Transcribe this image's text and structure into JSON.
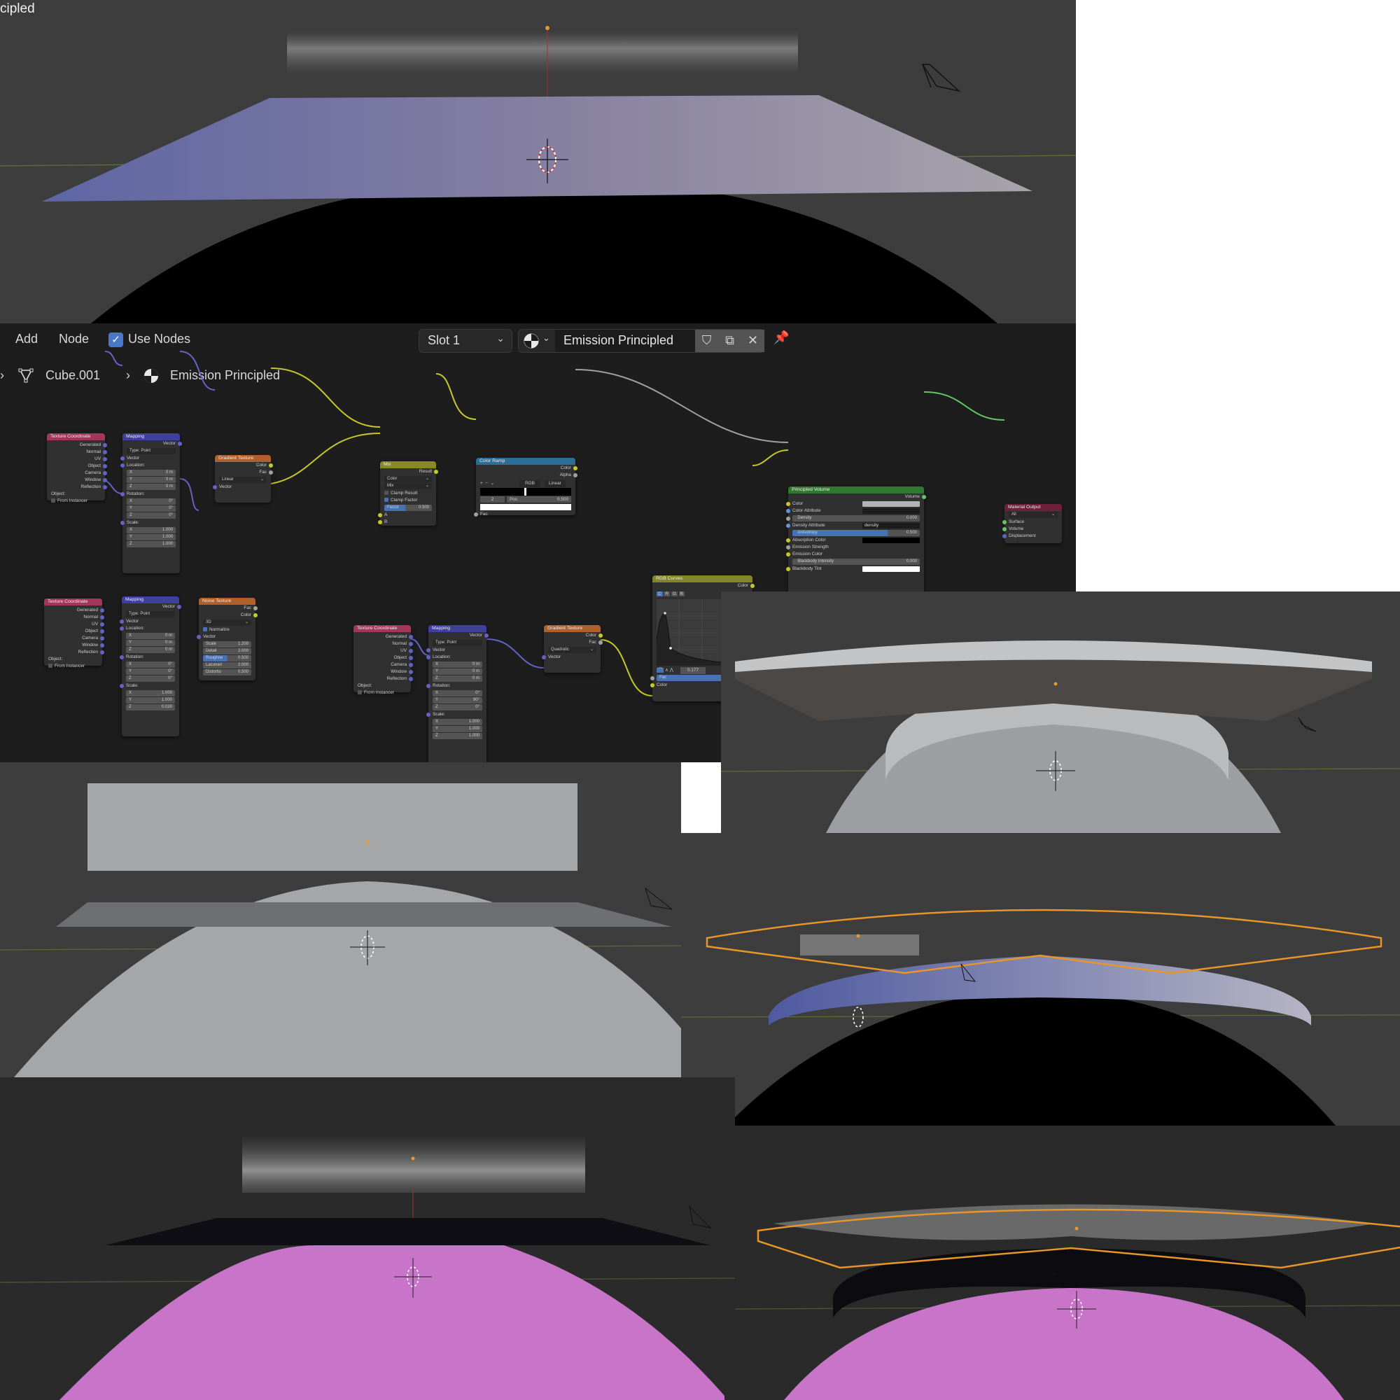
{
  "viewport_top": {
    "title_fragment": "cipled",
    "accent": "#e59a2e"
  },
  "node_editor": {
    "header": {
      "menu": [
        "Add",
        "Node"
      ],
      "use_nodes_label": "Use Nodes",
      "use_nodes_checked": true,
      "slot": "Slot 1",
      "material_name": "Emission Principled",
      "icons": [
        "material-sphere-icon",
        "fake-user-shield-icon",
        "duplicate-icon",
        "close-icon",
        "pin-icon"
      ]
    },
    "breadcrumb": {
      "object": "Cube.001",
      "material": "Emission Principled"
    },
    "nodes": {
      "texcoord1": {
        "title": "Texture Coordinate",
        "outputs": [
          "Generated",
          "Normal",
          "UV",
          "Object",
          "Camera",
          "Window",
          "Reflection"
        ],
        "object_label": "Object:",
        "from_instancer": "From Instancer"
      },
      "mapping1": {
        "title": "Mapping",
        "output": "Vector",
        "type_label": "Type:",
        "type_value": "Point",
        "vector_label": "Vector",
        "location_label": "Location:",
        "location": [
          [
            "X",
            "0 m"
          ],
          [
            "Y",
            "0 m"
          ],
          [
            "Z",
            "0 m"
          ]
        ],
        "rotation_label": "Rotation:",
        "rotation": [
          [
            "X",
            "0°"
          ],
          [
            "Y",
            "0°"
          ],
          [
            "Z",
            "0°"
          ]
        ],
        "scale_label": "Scale:",
        "scale": [
          [
            "X",
            "1.000"
          ],
          [
            "Y",
            "1.000"
          ],
          [
            "Z",
            "1.000"
          ]
        ]
      },
      "gradient1": {
        "title": "Gradient Texture",
        "outputs": [
          "Color",
          "Fac"
        ],
        "type": "Linear",
        "input": "Vector"
      },
      "mix": {
        "title": "Mix",
        "output": "Result",
        "data_type": "Color",
        "blend": "Mix",
        "clamp_result": "Clamp Result",
        "clamp_factor": "Clamp Factor",
        "factor_label": "Factor",
        "factor_value": "0.500",
        "inputs": [
          "A",
          "B"
        ]
      },
      "color_ramp": {
        "title": "Color Ramp",
        "outputs": [
          "Color",
          "Alpha"
        ],
        "controls": [
          "+",
          "−",
          "⌄"
        ],
        "color_mode": "RGB",
        "interpolation": "Linear",
        "index": "2",
        "pos_label": "Pos",
        "pos_value": "0.500",
        "input": "Fac"
      },
      "principled_volume": {
        "title": "Principled Volume",
        "output": "Volume",
        "rows": [
          {
            "label": "Color",
            "kind": "color",
            "swatch": "#b3b3b3",
            "socket": "yellow"
          },
          {
            "label": "Color Attribute",
            "kind": "text",
            "value": "",
            "socket": "blue"
          },
          {
            "label": "Density",
            "kind": "slider",
            "value": "0.000",
            "socket": "gray"
          },
          {
            "label": "Density Attribute",
            "kind": "text",
            "value": "density",
            "socket": "blue"
          },
          {
            "label": "Anisotropy",
            "kind": "slider",
            "value": "0.500",
            "fill": 0.75,
            "socket": "gray"
          },
          {
            "label": "Absorption Color",
            "kind": "color",
            "swatch": "#000000",
            "socket": "yellow"
          },
          {
            "label": "Emission Strength",
            "kind": "label",
            "socket": "gray"
          },
          {
            "label": "Emission Color",
            "kind": "label",
            "socket": "yellow"
          },
          {
            "label": "Blackbody Intensity",
            "kind": "slider",
            "value": "0.000",
            "socket": "gray"
          },
          {
            "label": "Blackbody Tint",
            "kind": "color",
            "swatch": "#ffffff",
            "socket": "yellow"
          }
        ]
      },
      "material_output": {
        "title": "Material Output",
        "target": "All",
        "inputs": [
          "Surface",
          "Volume",
          "Displacement"
        ]
      },
      "texcoord2": {
        "title": "Texture Coordinate",
        "outputs": [
          "Generated",
          "Normal",
          "UV",
          "Object",
          "Camera",
          "Window",
          "Reflection"
        ],
        "object_label": "Object:",
        "from_instancer": "From Instancer"
      },
      "mapping2": {
        "title": "Mapping",
        "output": "Vector",
        "type_label": "Type:",
        "type_value": "Point",
        "vector_label": "Vector",
        "location_label": "Location:",
        "location": [
          [
            "X",
            "0 m"
          ],
          [
            "Y",
            "0 m"
          ],
          [
            "Z",
            "0 m"
          ]
        ],
        "rotation_label": "Rotation:",
        "rotation": [
          [
            "X",
            "0°"
          ],
          [
            "Y",
            "0°"
          ],
          [
            "Z",
            "0°"
          ]
        ],
        "scale_label": "Scale:",
        "scale": [
          [
            "X",
            "1.000"
          ],
          [
            "Y",
            "1.000"
          ],
          [
            "Z",
            "0.020"
          ]
        ]
      },
      "noise": {
        "title": "Noise Texture",
        "outputs": [
          "Fac",
          "Color"
        ],
        "dimensions": "3D",
        "normalize": "Normalize",
        "input": "Vector",
        "params": [
          [
            "Scale",
            "1.200"
          ],
          [
            "Detail",
            "2.000"
          ],
          [
            "Roughne",
            "0.500"
          ],
          [
            "Lacunari",
            "2.000"
          ],
          [
            "Distortio",
            "0.500"
          ]
        ]
      },
      "texcoord3": {
        "title": "Texture Coordinate",
        "outputs": [
          "Generated",
          "Normal",
          "UV",
          "Object",
          "Camera",
          "Window",
          "Reflection"
        ],
        "object_label": "Object:",
        "from_instancer": "From Instancer"
      },
      "mapping3": {
        "title": "Mapping",
        "output": "Vector",
        "type_label": "Type:",
        "type_value": "Point",
        "vector_label": "Vector",
        "location_label": "Location:",
        "location": [
          [
            "X",
            "0 m"
          ],
          [
            "Y",
            "0 m"
          ],
          [
            "Z",
            "0 m"
          ]
        ],
        "rotation_label": "Rotation:",
        "rotation": [
          [
            "X",
            "0°"
          ],
          [
            "Y",
            "90°"
          ],
          [
            "Z",
            "0°"
          ]
        ],
        "scale_label": "Scale:",
        "scale": [
          [
            "X",
            "1.000"
          ],
          [
            "Y",
            "1.000"
          ],
          [
            "Z",
            "1.000"
          ]
        ]
      },
      "gradient2": {
        "title": "Gradient Texture",
        "outputs": [
          "Color",
          "Fac"
        ],
        "type": "Quadratic",
        "input": "Vector"
      },
      "rgb_curves": {
        "title": "RGB Curves",
        "output": "Color",
        "channels": [
          "C",
          "R",
          "G",
          "B"
        ],
        "active_channel": "C",
        "point_value": "0.177",
        "inputs": [
          "Fac",
          "Color"
        ]
      }
    },
    "colors": {
      "texcoord_header": "#a3375a",
      "mapping_header": "#3f3fa0",
      "texture_header": "#b0602a",
      "mix_header": "#8a8a22",
      "ramp_header": "#2b6f99",
      "shader_header": "#2f7a2f",
      "output_header": "#6e2038",
      "curves_header": "#84842a"
    }
  },
  "viewports": {
    "solid_views": 2,
    "material_preview_views": 2,
    "selection_outline": "#e8952a",
    "emission_pink": "#c874c9"
  }
}
